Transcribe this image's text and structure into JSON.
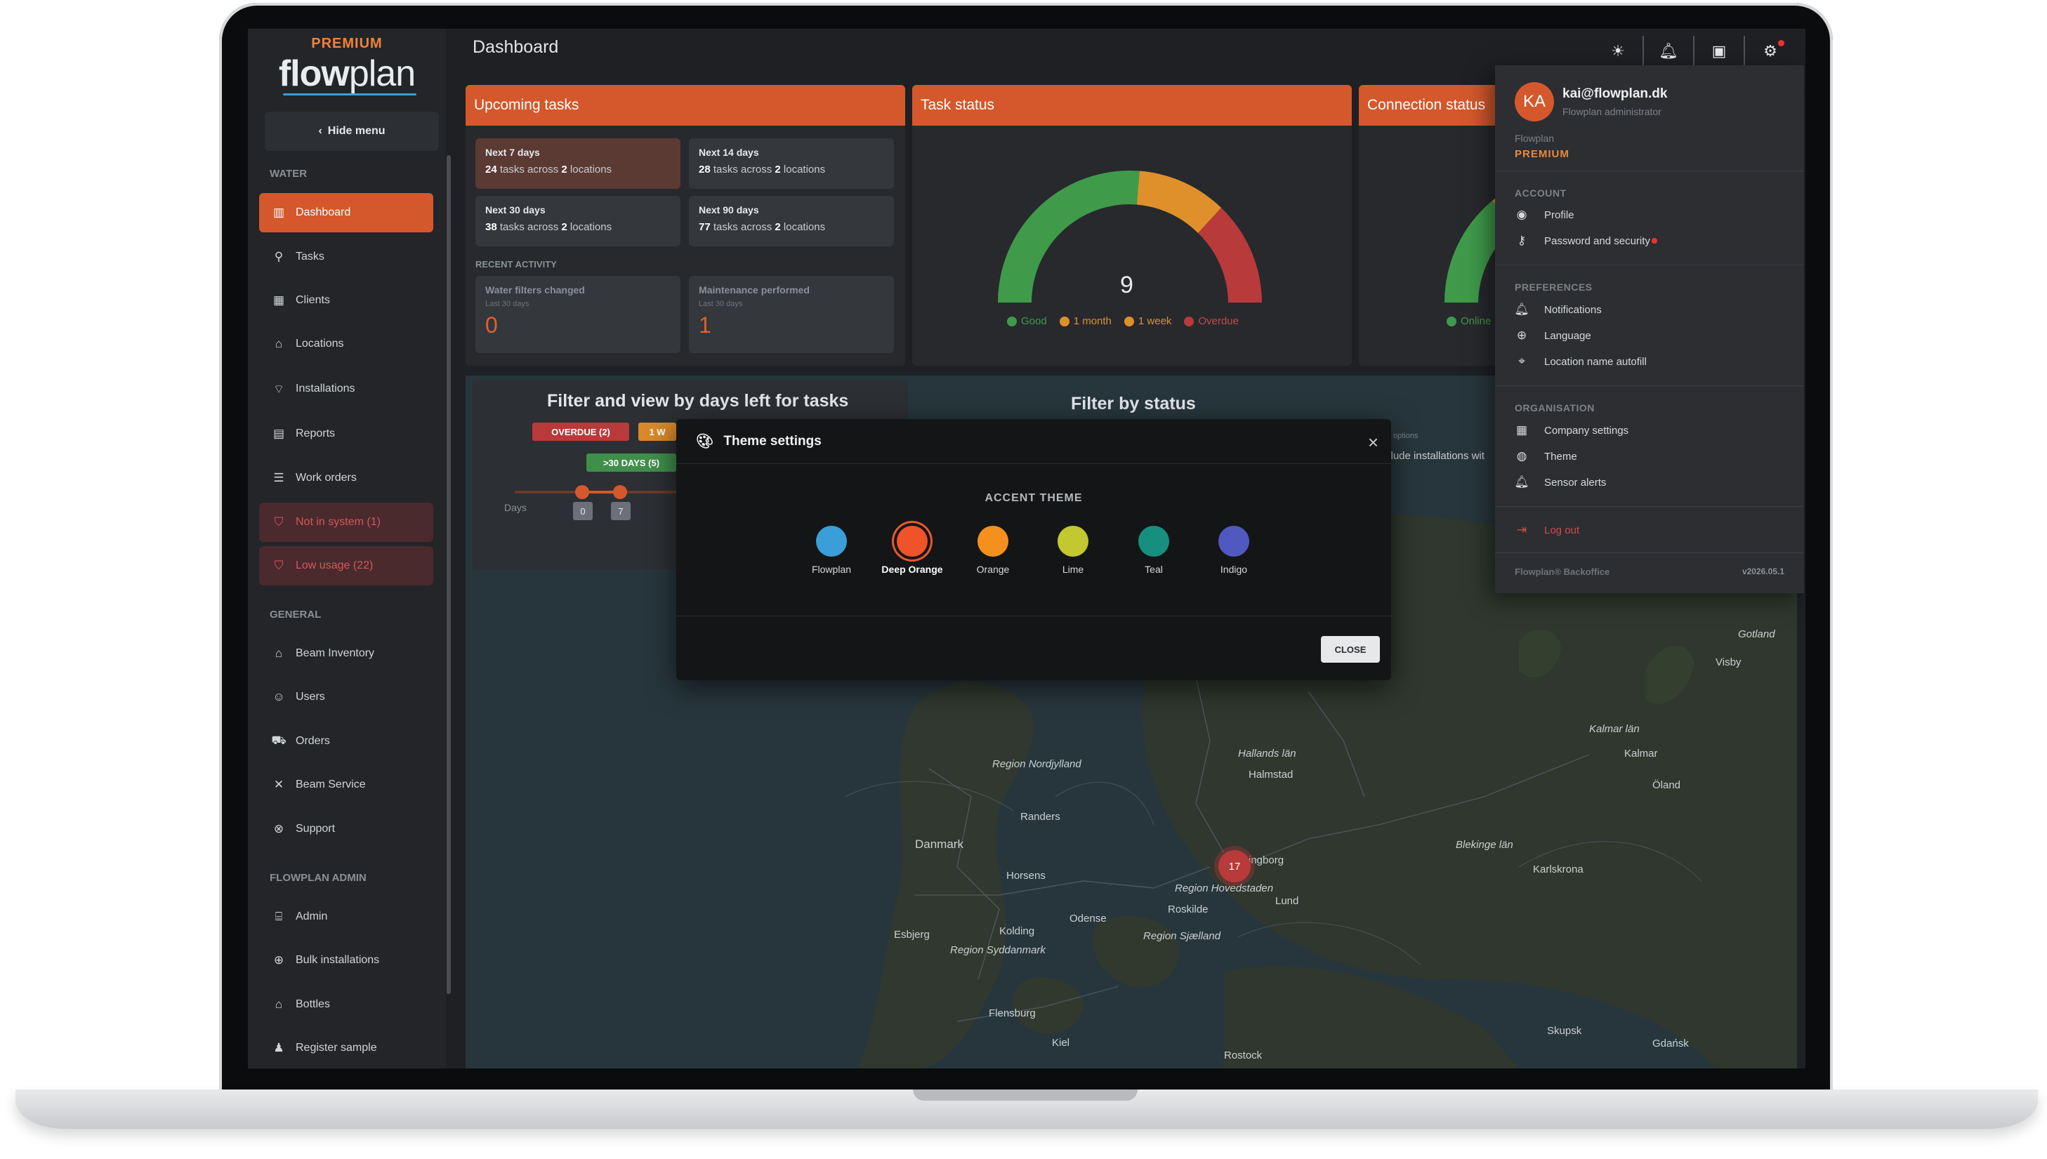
{
  "brand": {
    "tier": "PREMIUM",
    "logo_bold": "flow",
    "logo_light": "plan"
  },
  "sidebar": {
    "hide_menu": "Hide menu",
    "sections": {
      "water": "WATER",
      "general": "GENERAL",
      "admin": "FLOWPLAN ADMIN"
    },
    "water_items": [
      {
        "label": "Dashboard",
        "icon": "dashboard-icon"
      },
      {
        "label": "Tasks",
        "icon": "tasks-icon"
      },
      {
        "label": "Clients",
        "icon": "clients-icon"
      },
      {
        "label": "Locations",
        "icon": "home-icon"
      },
      {
        "label": "Installations",
        "icon": "installations-icon"
      },
      {
        "label": "Reports",
        "icon": "report-icon"
      },
      {
        "label": "Work orders",
        "icon": "checklist-icon"
      },
      {
        "label": "Not in system (1)",
        "icon": "shield-icon"
      },
      {
        "label": "Low usage (22)",
        "icon": "shield-icon"
      }
    ],
    "general_items": [
      {
        "label": "Beam Inventory",
        "icon": "warehouse-icon"
      },
      {
        "label": "Users",
        "icon": "users-icon"
      },
      {
        "label": "Orders",
        "icon": "cart-icon"
      },
      {
        "label": "Beam Service",
        "icon": "tools-icon"
      },
      {
        "label": "Support",
        "icon": "lifebuoy-icon"
      }
    ],
    "admin_items": [
      {
        "label": "Admin",
        "icon": "bank-icon"
      },
      {
        "label": "Bulk installations",
        "icon": "plus-circle-icon"
      },
      {
        "label": "Bottles",
        "icon": "warehouse-icon"
      },
      {
        "label": "Register sample",
        "icon": "person-icon"
      }
    ]
  },
  "header": {
    "title": "Dashboard"
  },
  "upcoming": {
    "title": "Upcoming tasks",
    "tiles": [
      {
        "title": "Next 7 days",
        "count": "24",
        "mid": " tasks across ",
        "locs": "2",
        "end": " locations"
      },
      {
        "title": "Next 14 days",
        "count": "28",
        "mid": " tasks across ",
        "locs": "2",
        "end": " locations"
      },
      {
        "title": "Next 30 days",
        "count": "38",
        "mid": " tasks across ",
        "locs": "2",
        "end": " locations"
      },
      {
        "title": "Next 90 days",
        "count": "77",
        "mid": " tasks across ",
        "locs": "2",
        "end": " locations"
      }
    ],
    "recent_label": "RECENT ACTIVITY",
    "activity": [
      {
        "title": "Water filters changed",
        "sub": "Last 30 days",
        "value": "0"
      },
      {
        "title": "Maintenance performed",
        "sub": "Last 30 days",
        "value": "1"
      }
    ]
  },
  "task_status": {
    "title": "Task status",
    "value": "9",
    "legend": [
      {
        "label": "Good",
        "color": "#3f9b4a"
      },
      {
        "label": "1 month",
        "color": "#e0902a"
      },
      {
        "label": "1 week",
        "color": "#e0902a"
      },
      {
        "label": "Overdue",
        "color": "#b83a3a"
      }
    ]
  },
  "connection": {
    "title": "Connection status",
    "legend_online": "Online"
  },
  "filters": {
    "days_title": "Filter and view by days left for tasks",
    "status_title": "Filter by status",
    "overdue_pill": "OVERDUE (2)",
    "week_pill": "1 W",
    "days30_pill": ">30 DAYS (5)",
    "days_label": "Days",
    "slider_min": "0",
    "slider_max": "7",
    "partial_text": "clude installations wit",
    "partial_options": "w options"
  },
  "map": {
    "cluster": "17",
    "labels": [
      "Danmark",
      "Halmstad",
      "Helsingborg",
      "Lund",
      "Odense",
      "Kolding",
      "Esbjerg",
      "Randers",
      "Horsens",
      "Roskilde",
      "Kiel",
      "Kalmar",
      "Gdańsk",
      "Karlskrona",
      "Region Nordjylland",
      "Region Syddanmark",
      "Region Sjælland",
      "Region Hovedstaden",
      "Flensburg",
      "Gotland",
      "Visby",
      "Skupsk",
      "Rostock",
      "Öland",
      "Blekinge län",
      "Kalmar län",
      "Hallands län"
    ]
  },
  "modal": {
    "title": "Theme settings",
    "section": "ACCENT THEME",
    "swatches": [
      {
        "label": "Flowplan",
        "color": "#3a9ed8"
      },
      {
        "label": "Deep Orange",
        "color": "#f0522a"
      },
      {
        "label": "Orange",
        "color": "#f5901e"
      },
      {
        "label": "Lime",
        "color": "#c3c730"
      },
      {
        "label": "Teal",
        "color": "#178f7f"
      },
      {
        "label": "Indigo",
        "color": "#5158c0"
      }
    ],
    "selected": "Deep Orange",
    "close_label": "CLOSE"
  },
  "profile": {
    "initials": "KA",
    "email": "kai@flowplan.dk",
    "role": "Flowplan administrator",
    "org": "Flowplan",
    "tier": "PREMIUM",
    "account_label": "ACCOUNT",
    "account_items": [
      {
        "label": "Profile",
        "icon": "user-circle-icon"
      },
      {
        "label": "Password and security",
        "icon": "key-icon"
      }
    ],
    "preferences_label": "PREFERENCES",
    "preference_items": [
      {
        "label": "Notifications",
        "icon": "bell-icon"
      },
      {
        "label": "Language",
        "icon": "globe-icon"
      },
      {
        "label": "Location name autofill",
        "icon": "tag-icon"
      }
    ],
    "organisation_label": "ORGANISATION",
    "organisation_items": [
      {
        "label": "Company settings",
        "icon": "building-icon"
      },
      {
        "label": "Theme",
        "icon": "palette-icon"
      },
      {
        "label": "Sensor alerts",
        "icon": "bell-icon"
      }
    ],
    "logout": "Log out",
    "footer_left": "Flowplan® Backoffice",
    "footer_right": "v2026.05.1"
  }
}
